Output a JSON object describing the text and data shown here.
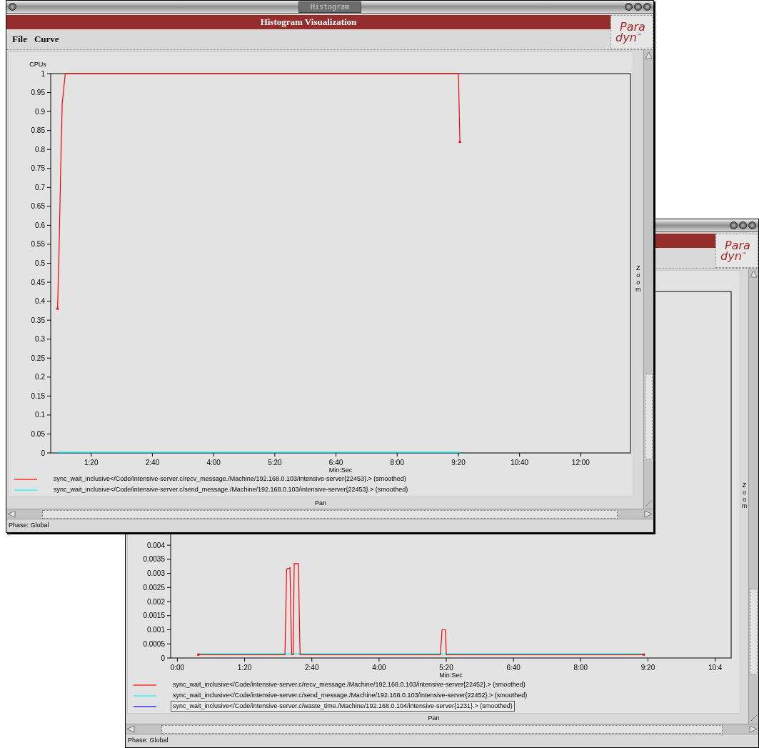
{
  "front_window": {
    "title": "Histogram",
    "header": "Histogram Visualization",
    "logo": {
      "top": "Para",
      "bottom": "dyn",
      "mark": "™"
    },
    "menu": [
      {
        "label": "File"
      },
      {
        "label": "Curve"
      }
    ],
    "chart_data": {
      "type": "line",
      "ylabel": "CPUs",
      "xlabel": "Min:Sec",
      "x": [
        36,
        38,
        40,
        42,
        46,
        560,
        562
      ],
      "xlim": [
        27,
        785
      ],
      "ylim": [
        0,
        1
      ],
      "xticks": [
        {
          "value": 80,
          "label": "1:20"
        },
        {
          "value": 160,
          "label": "2:40"
        },
        {
          "value": 240,
          "label": "4:00"
        },
        {
          "value": 320,
          "label": "5:20"
        },
        {
          "value": 400,
          "label": "6:40"
        },
        {
          "value": 480,
          "label": "8:00"
        },
        {
          "value": 560,
          "label": "9:20"
        },
        {
          "value": 640,
          "label": "10:40"
        },
        {
          "value": 720,
          "label": "12:00"
        }
      ],
      "yticks": [
        0,
        0.05,
        0.1,
        0.15,
        0.2,
        0.25,
        0.3,
        0.35,
        0.4,
        0.45,
        0.5,
        0.55,
        0.6,
        0.65,
        0.7,
        0.75,
        0.8,
        0.85,
        0.9,
        0.95,
        1
      ],
      "series": [
        {
          "name": "sync_wait_inclusive</Code/intensive-server.c/recv_message./Machine/192.168.0.103/intensive-server{22453}.> (smoothed)",
          "color": "#ff0000",
          "values": [
            0.38,
            0.54,
            0.74,
            0.92,
            1,
            1,
            0.82
          ]
        },
        {
          "name": "sync_wait_inclusive</Code/intensive-server.c/send_message./Machine/192.168.0.103/intensive-server{22453}.> (smoothed)",
          "color": "#00ffff",
          "values": [
            0.002,
            0.002,
            0.002,
            0.002,
            0.002,
            0.002,
            0.002
          ]
        }
      ]
    },
    "legend_entries": [
      {
        "selected": false
      },
      {
        "selected": false
      }
    ],
    "zoom_label": "Zoom",
    "pan_label": "Pan",
    "status": "Phase: Global"
  },
  "back_window": {
    "logo": {
      "top": "Para",
      "bottom": "dyn",
      "mark": "™"
    },
    "chart_data": {
      "type": "line",
      "xlabel": "Min:Sec",
      "x": [
        25,
        128,
        130,
        134,
        136,
        138,
        139,
        144,
        146,
        313,
        315,
        319,
        320,
        555
      ],
      "xlim": [
        -8,
        659
      ],
      "ylim": [
        0,
        0.013
      ],
      "xticks": [
        {
          "value": 0,
          "label": "0:00"
        },
        {
          "value": 80,
          "label": "1:20"
        },
        {
          "value": 160,
          "label": "2:40"
        },
        {
          "value": 240,
          "label": "4:00"
        },
        {
          "value": 320,
          "label": "5:20"
        },
        {
          "value": 400,
          "label": "6:40"
        },
        {
          "value": 480,
          "label": "8:00"
        },
        {
          "value": 560,
          "label": "9:20"
        },
        {
          "value": 640,
          "label": "10:4"
        }
      ],
      "yticks": [
        0,
        0.0005,
        0.001,
        0.0015,
        0.002,
        0.0025,
        0.003,
        0.0035,
        0.004
      ],
      "series": [
        {
          "name": "sync_wait_inclusive</Code/intensive-server.c/recv_message./Machine/192.168.0.103/intensive-server{22452}.> (smoothed)",
          "color": "#ff0000",
          "values": [
            0.00012,
            0.00012,
            0.00315,
            0.0032,
            0.00012,
            0.00012,
            0.00335,
            0.00335,
            0.00012,
            0.00012,
            0.001,
            0.001,
            0.00012,
            0.00012
          ]
        },
        {
          "name": "sync_wait_inclusive</Code/intensive-server.c/send_message./Machine/192.168.0.103/intensive-server{22452}.> (smoothed)",
          "color": "#00ffff",
          "values": [
            0.00015,
            0.00015,
            0.00015,
            0.00015,
            0.00015,
            0.00015,
            0.00015,
            0.00015,
            0.00015,
            0.00015,
            0.00015,
            0.00015,
            0.00015,
            0.00015
          ]
        },
        {
          "name": "sync_wait_inclusive</Code/intensive-server.c/waste_time./Machine/192.168.0.104/intensive-server{1231}.> (smoothed)",
          "color": "#0000ff",
          "values": [
            null,
            null,
            null,
            null,
            null,
            null,
            null,
            null,
            null,
            null,
            null,
            null,
            null,
            null
          ]
        }
      ]
    },
    "legend_entries": [
      {
        "selected": false
      },
      {
        "selected": false
      },
      {
        "selected": true
      }
    ],
    "zoom_label": "Zoom",
    "pan_label": "Pan",
    "status": "Phase: Global"
  }
}
